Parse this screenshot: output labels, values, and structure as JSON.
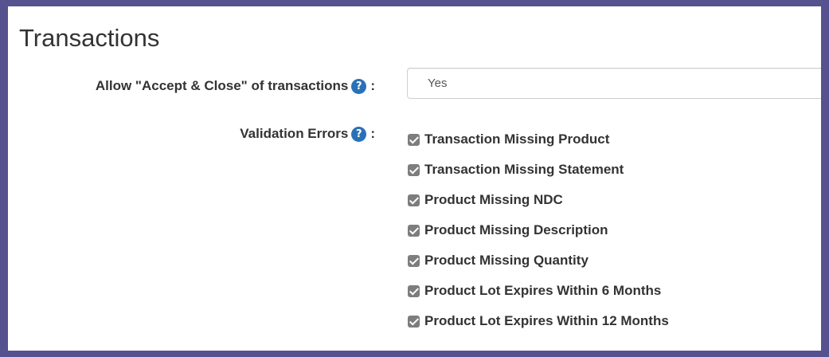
{
  "section": {
    "title": "Transactions"
  },
  "accept_close": {
    "label": "Allow \"Accept & Close\" of transactions",
    "help_icon": "question-circle-icon",
    "colon": ":",
    "value": "Yes"
  },
  "validation_errors": {
    "label": "Validation Errors",
    "help_icon": "question-circle-icon",
    "colon": ":",
    "items": [
      {
        "label": "Transaction Missing Product",
        "checked": true
      },
      {
        "label": "Transaction Missing Statement",
        "checked": true
      },
      {
        "label": "Product Missing NDC",
        "checked": true
      },
      {
        "label": "Product Missing Description",
        "checked": true
      },
      {
        "label": "Product Missing Quantity",
        "checked": true
      },
      {
        "label": "Product Lot Expires Within 6 Months",
        "checked": true
      },
      {
        "label": "Product Lot Expires Within 12 Months",
        "checked": true
      }
    ]
  },
  "colors": {
    "frame": "#56518f",
    "help_icon": "#2a70b8",
    "checkbox": "#7d7d7d",
    "text": "#333333"
  }
}
